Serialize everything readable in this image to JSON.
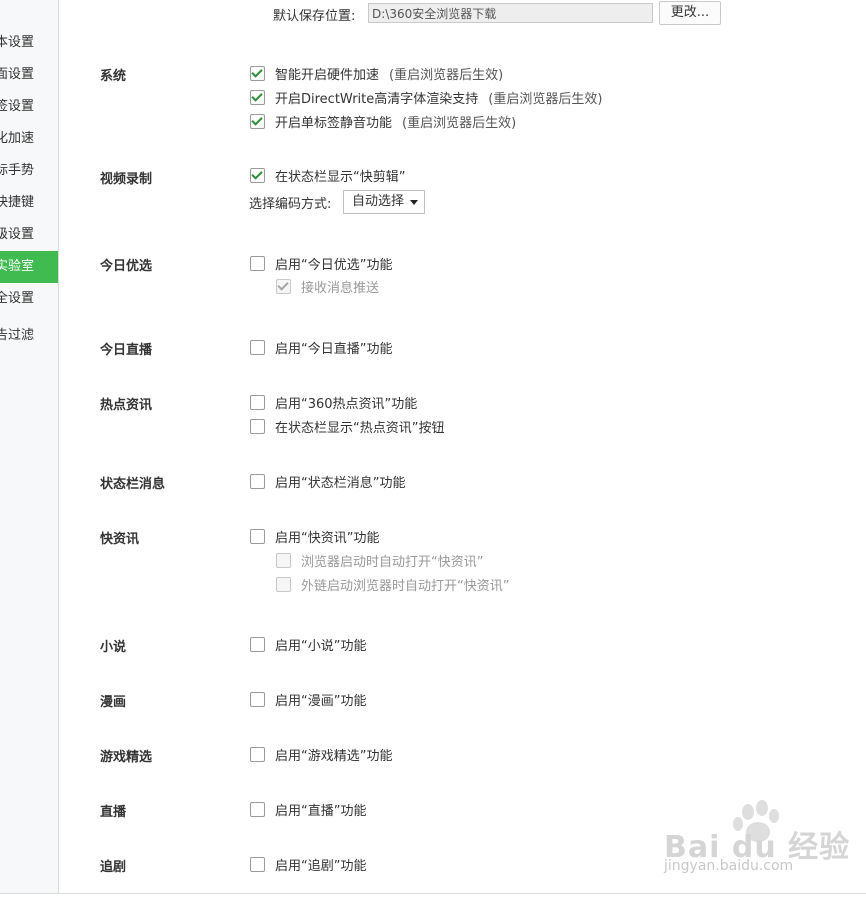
{
  "sidebar": {
    "items": [
      {
        "label": "本设置",
        "active": false
      },
      {
        "label": "面设置",
        "active": false
      },
      {
        "label": "签设置",
        "active": false
      },
      {
        "label": "化加速",
        "active": false
      },
      {
        "label": "标手势",
        "active": false
      },
      {
        "label": "快捷键",
        "active": false
      },
      {
        "label": "级设置",
        "active": false
      },
      {
        "label": "实验室",
        "active": true
      },
      {
        "label": "全设置",
        "active": false
      },
      {
        "label": "告过滤",
        "active": false
      }
    ],
    "active_color": "#3fbb50"
  },
  "download": {
    "label": "默认保存位置:",
    "path": "D:\\360安全浏览器下载",
    "change_label": "更改..."
  },
  "sections": {
    "system": {
      "title": "系统",
      "opt1": {
        "label": "智能开启硬件加速",
        "note": "(重启浏览器后生效)",
        "checked": true
      },
      "opt2": {
        "label": "开启DirectWrite高清字体渲染支持",
        "note": "(重启浏览器后生效)",
        "checked": true
      },
      "opt3": {
        "label": "开启单标签静音功能",
        "note": "(重启浏览器后生效)",
        "checked": true
      }
    },
    "video": {
      "title": "视频录制",
      "opt1": {
        "label": "在状态栏显示“快剪辑”",
        "checked": true
      },
      "codec_label": "选择编码方式:",
      "codec_value": "自动选择"
    },
    "today_pick": {
      "title": "今日优选",
      "opt1": {
        "label": "启用“今日优选”功能",
        "checked": false
      },
      "sub1": {
        "label": "接收消息推送",
        "checked": true,
        "disabled": true
      }
    },
    "today_live": {
      "title": "今日直播",
      "opt1": {
        "label": "启用“今日直播”功能",
        "checked": false
      }
    },
    "hot_news": {
      "title": "热点资讯",
      "opt1": {
        "label": "启用“360热点资讯”功能",
        "checked": false
      },
      "opt2": {
        "label": "在状态栏显示“热点资讯”按钮",
        "checked": false
      }
    },
    "status_msg": {
      "title": "状态栏消息",
      "opt1": {
        "label": "启用“状态栏消息”功能",
        "checked": false
      }
    },
    "quick_news": {
      "title": "快资讯",
      "opt1": {
        "label": "启用“快资讯”功能",
        "checked": false
      },
      "sub1": {
        "label": "浏览器启动时自动打开“快资讯”",
        "checked": false,
        "disabled": true
      },
      "sub2": {
        "label": "外链启动浏览器时自动打开“快资讯”",
        "checked": false,
        "disabled": true
      }
    },
    "novel": {
      "title": "小说",
      "opt1": {
        "label": "启用“小说”功能",
        "checked": false
      }
    },
    "comic": {
      "title": "漫画",
      "opt1": {
        "label": "启用“漫画”功能",
        "checked": false
      }
    },
    "games": {
      "title": "游戏精选",
      "opt1": {
        "label": "启用“游戏精选”功能",
        "checked": false
      }
    },
    "live": {
      "title": "直播",
      "opt1": {
        "label": "启用“直播”功能",
        "checked": false
      }
    },
    "drama": {
      "title": "追剧",
      "opt1": {
        "label": "启用“追剧”功能",
        "checked": false
      }
    }
  },
  "watermark": {
    "brand": "Bai du 经验",
    "url": "jingyan.baidu.com"
  }
}
